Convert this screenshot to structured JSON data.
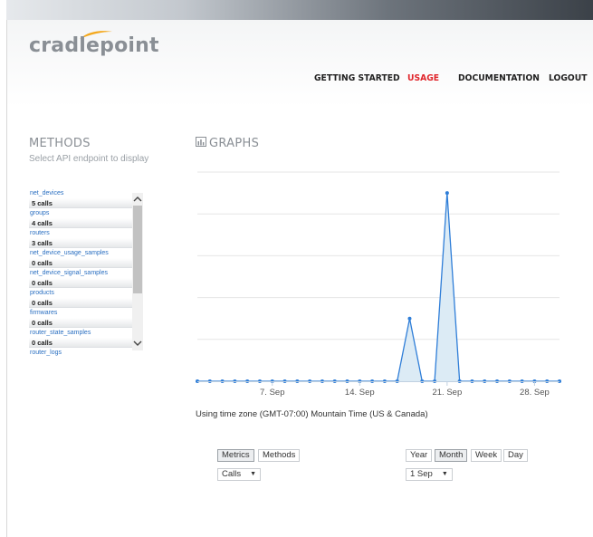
{
  "brand": {
    "logo_text": "cradlepoint"
  },
  "nav": {
    "items": [
      {
        "label": "GETTING STARTED",
        "active": false
      },
      {
        "label": "USAGE",
        "active": true
      },
      {
        "label": "DOCUMENTATION",
        "active": false
      },
      {
        "label": "LOGOUT",
        "active": false
      }
    ]
  },
  "methods": {
    "title": "METHODS",
    "subtitle": "Select API endpoint to display",
    "items": [
      {
        "name": "net_devices",
        "calls": "5 calls"
      },
      {
        "name": "groups",
        "calls": "4 calls"
      },
      {
        "name": "routers",
        "calls": "3 calls"
      },
      {
        "name": "net_device_usage_samples",
        "calls": "0 calls"
      },
      {
        "name": "net_device_signal_samples",
        "calls": "0 calls"
      },
      {
        "name": "products",
        "calls": "0 calls"
      },
      {
        "name": "firmwares",
        "calls": "0 calls"
      },
      {
        "name": "router_state_samples",
        "calls": "0 calls"
      },
      {
        "name": "router_logs",
        "calls": ""
      }
    ]
  },
  "graphs": {
    "title": "GRAPHS",
    "timezone_note": "Using time zone (GMT-07:00) Mountain Time (US & Canada)"
  },
  "chart_data": {
    "type": "area",
    "title": "",
    "xlabel": "",
    "ylabel": "",
    "x": [
      "1 Sep",
      "2 Sep",
      "3 Sep",
      "4 Sep",
      "5 Sep",
      "6 Sep",
      "7 Sep",
      "8 Sep",
      "9 Sep",
      "10 Sep",
      "11 Sep",
      "12 Sep",
      "13 Sep",
      "14 Sep",
      "15 Sep",
      "16 Sep",
      "17 Sep",
      "18 Sep",
      "19 Sep",
      "20 Sep",
      "21 Sep",
      "22 Sep",
      "23 Sep",
      "24 Sep",
      "25 Sep",
      "26 Sep",
      "27 Sep",
      "28 Sep",
      "29 Sep",
      "30 Sep"
    ],
    "series": [
      {
        "values": [
          0,
          0,
          0,
          0,
          0,
          0,
          0,
          0,
          0,
          0,
          0,
          0,
          0,
          0,
          0,
          0,
          0,
          3,
          0,
          0,
          9,
          0,
          0,
          0,
          0,
          0,
          0,
          0,
          0,
          0
        ]
      }
    ],
    "xticks": [
      "7. Sep",
      "14. Sep",
      "21. Sep",
      "28. Sep"
    ],
    "xtick_days": [
      7,
      14,
      21,
      28
    ],
    "ylim": [
      0,
      10
    ],
    "grid": true,
    "color": "#2f7ed8",
    "fill_color": "#dcebf5"
  },
  "controls": {
    "view_tabs": [
      {
        "label": "Metrics",
        "active": true
      },
      {
        "label": "Methods",
        "active": false
      }
    ],
    "metric_select": "Calls",
    "period_tabs": [
      {
        "label": "Year",
        "active": false
      },
      {
        "label": "Month",
        "active": true
      },
      {
        "label": "Week",
        "active": false
      },
      {
        "label": "Day",
        "active": false
      }
    ],
    "date_select": "1 Sep"
  }
}
